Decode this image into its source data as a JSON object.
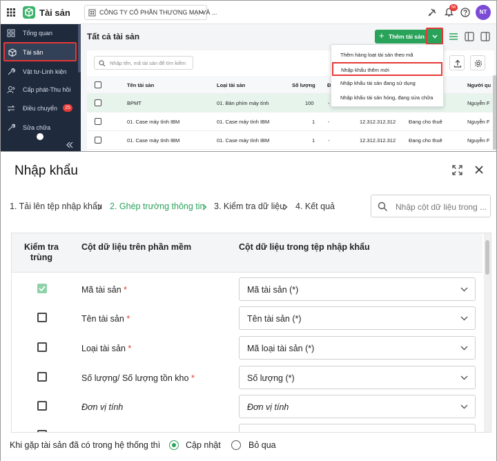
{
  "app": {
    "name": "Tài sản",
    "company": "CÔNG TY CỔ PHẦN THƯƠNG MẠI VÀ ...",
    "notification_count": "56",
    "user_initials": "NT"
  },
  "sidebar": {
    "items": [
      {
        "label": "Tổng quan",
        "icon": "dashboard-icon"
      },
      {
        "label": "Tài sản",
        "icon": "cube-icon",
        "active": true
      },
      {
        "label": "Vật tư-Linh kiện",
        "icon": "wrench-icon"
      },
      {
        "label": "Cấp phát-Thu hồi",
        "icon": "user-transfer-icon"
      },
      {
        "label": "Điều chuyển",
        "icon": "swap-icon",
        "badge": "25"
      },
      {
        "label": "Sửa chữa",
        "icon": "tool-icon"
      }
    ]
  },
  "page": {
    "title": "Tất cả tài sản",
    "add_button": "Thêm tài sản",
    "search_placeholder": "Nhập tên, mã tài sản để tìm kiếm"
  },
  "dropdown_menu": {
    "items": [
      "Thêm hàng loạt tài sản theo mã",
      "Nhập khẩu thêm mới",
      "Nhập khẩu tài sản đang sử dụng",
      "Nhập khẩu tài sản hỏng, đang sửa chữa"
    ],
    "highlighted_index": 1
  },
  "asset_table": {
    "columns": [
      "Tên tài sản",
      "Loại tài sản",
      "Số lượng",
      "Đ",
      "Người qu"
    ],
    "rows": [
      {
        "name": "BPMT",
        "type": "01. Bàn phím máy tính",
        "qty": "100",
        "col4": "-",
        "value": "",
        "status": "",
        "owner": "Nguyễn F"
      },
      {
        "name": "01. Case máy tính IBM",
        "type": "01. Case máy tính IBM",
        "qty": "1",
        "col4": "-",
        "value": "12.312.312.312",
        "status": "Đang cho thuê",
        "owner": "Nguyễn F"
      },
      {
        "name": "01. Case máy tính IBM",
        "type": "01. Case máy tính IBM",
        "qty": "1",
        "col4": "-",
        "value": "12.312.312.312",
        "status": "Đang cho thuê",
        "owner": "Nguyễn F"
      }
    ]
  },
  "import_dialog": {
    "title": "Nhập khẩu",
    "steps": [
      {
        "label": "1. Tải lên tệp nhập khẩu",
        "current": false
      },
      {
        "label": "2. Ghép trường thông tin",
        "current": true
      },
      {
        "label": "3. Kiểm tra dữ liệu",
        "current": false
      },
      {
        "label": "4. Kết quả",
        "current": false
      }
    ],
    "search_placeholder": "Nhập cột dữ liệu trong ...",
    "headers": {
      "check_duplicate": "Kiểm tra trùng",
      "software_column": "Cột dữ liệu trên phần mềm",
      "file_column": "Cột dữ liệu trong tệp nhập khẩu"
    },
    "rows": [
      {
        "label": "Mã tài sản",
        "required": "*",
        "checked": true,
        "mapped": "Mã tài sản (*)",
        "label_italic": false
      },
      {
        "label": "Tên tài sản",
        "required": "*",
        "checked": false,
        "mapped": "Tên tài sản (*)",
        "label_italic": false
      },
      {
        "label": "Loại tài sản",
        "required": "*",
        "checked": false,
        "mapped": "Mã loại tài sản (*)",
        "label_italic": false
      },
      {
        "label": "Số lượng/ Số lượng tồn kho",
        "required": "*",
        "checked": false,
        "mapped": "Số lượng (*)",
        "label_italic": false
      },
      {
        "label": "Đơn vị tính",
        "required": "",
        "checked": false,
        "mapped": "Đơn vị tính",
        "label_italic": true
      }
    ],
    "footer": {
      "question": "Khi gặp tài sản đã có trong hệ thống thì",
      "option_update": "Cập nhật",
      "option_skip": "Bỏ qua",
      "selected": "update"
    }
  },
  "colors": {
    "accent": "#2aa35a",
    "highlight_border": "#e53935",
    "sidebar_bg": "#1f2a3d"
  }
}
